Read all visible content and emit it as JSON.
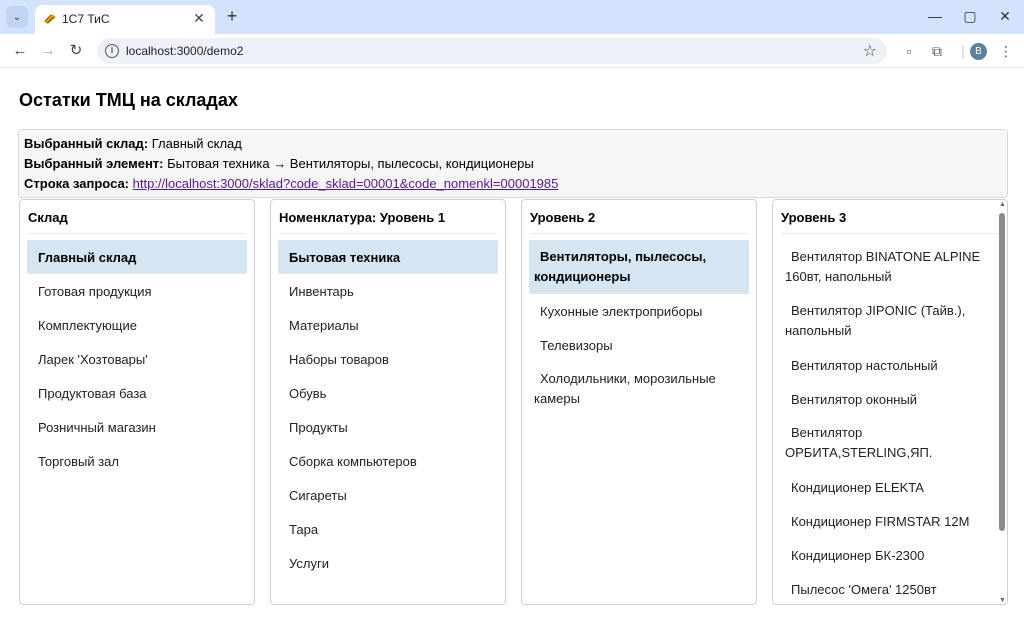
{
  "browser": {
    "tab_title": "1С7 ТиС",
    "url": "localhost:3000/demo2",
    "profile_initial": "B"
  },
  "page": {
    "title": "Остатки ТМЦ на складах"
  },
  "info": {
    "warehouse_label": "Выбранный склад:",
    "warehouse_value": "Главный склад",
    "element_label": "Выбранный элемент:",
    "element_value": "Бытовая техника → Вентиляторы, пылесосы, кондиционеры",
    "query_label": "Строка запроса:",
    "query_url": "http://localhost:3000/sklad?code_sklad=00001&code_nomenkl=00001985"
  },
  "columns": {
    "warehouse": {
      "title": "Склад",
      "items": [
        "Главный склад",
        "Готовая продукция",
        "Комплектующие",
        "Ларек 'Хозтовары'",
        "Продуктовая база",
        "Розничный магазин",
        "Торговый зал"
      ],
      "selected_index": 0
    },
    "level1": {
      "title": "Номенклатура: Уровень 1",
      "items": [
        "Бытовая техника",
        "Инвентарь",
        "Материалы",
        "Наборы товаров",
        "Обувь",
        "Продукты",
        "Сборка компьютеров",
        "Сигареты",
        "Тара",
        "Услуги"
      ],
      "selected_index": 0
    },
    "level2": {
      "title": "Уровень 2",
      "items": [
        "Вентиляторы, пылесосы, кондиционеры",
        "Кухонные электроприборы",
        "Телевизоры",
        "Холодильники, морозильные камеры"
      ],
      "selected_index": 0
    },
    "level3": {
      "title": "Уровень 3",
      "items": [
        "Вентилятор BINATONE ALPINE 160вт, напольный",
        "Вентилятор JIPONIC (Тайв.), напольный",
        "Вентилятор настольный",
        "Вентилятор оконный",
        "Вентилятор ОРБИТА,STERLING,ЯП.",
        "Кондиционер ELEKTA",
        "Кондиционер FIRMSTAR 12М",
        "Кондиционер БК-2300",
        "Пылесос 'Омега' 1250вт"
      ]
    }
  }
}
